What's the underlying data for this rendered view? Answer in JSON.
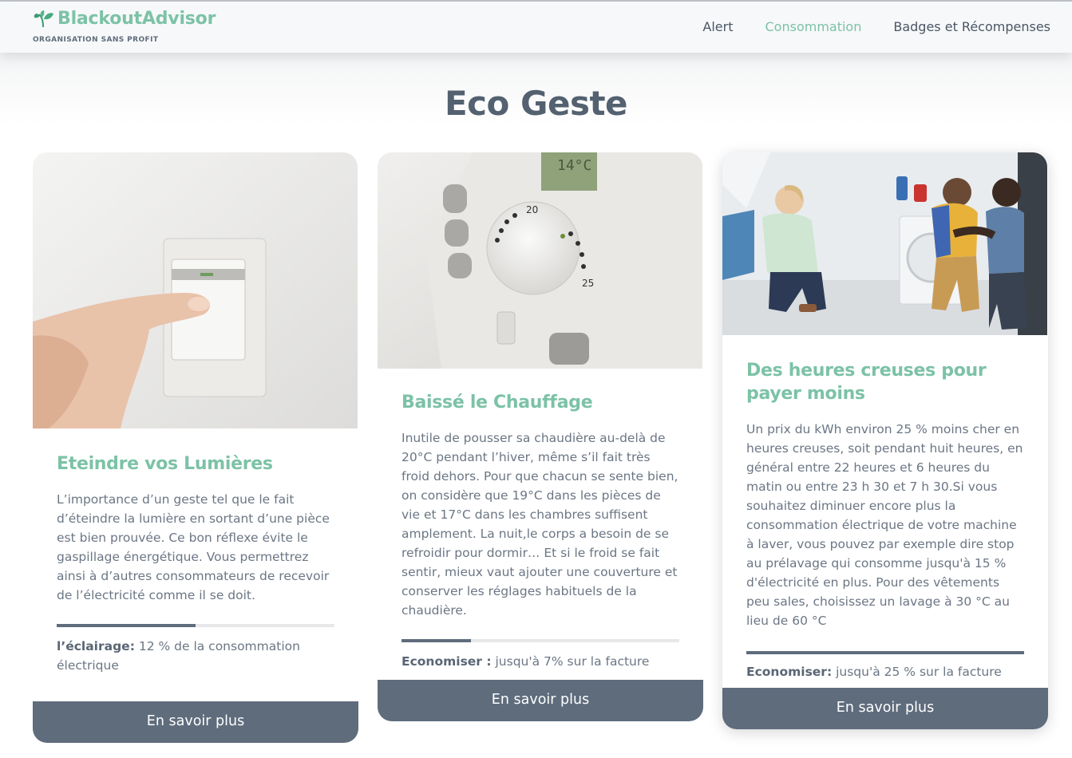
{
  "header": {
    "brand_name": "BlackoutAdvisor",
    "brand_subtitle": "ORGANISATION SANS PROFIT",
    "nav": [
      {
        "label": "Alert",
        "active": false
      },
      {
        "label": "Consommation",
        "active": true
      },
      {
        "label": "Badges et Récompenses",
        "active": false
      }
    ]
  },
  "page_title": "Eco Geste",
  "cards": [
    {
      "image": "hand-pressing-light-switch",
      "title": "Eteindre vos Lumières",
      "description": "L’importance d’un geste tel que le fait d’éteindre la lumière en sortant d’une pièce est bien prouvée. Ce bon réflexe évite le gaspillage énergétique. Vous permettrez ainsi à d’autres consommateurs de recevoir de l’électricité comme il se doit.",
      "progress": 0.5,
      "saving_label": "l’éclairage:",
      "saving_text": " 12 % de la consommation électrique",
      "button": "En savoir plus"
    },
    {
      "image": "thermostat-dial",
      "title": "Baissé le Chauffage",
      "description": "Inutile de pousser sa chaudière au-delà de 20°C pendant l’hiver, même s’il fait très froid dehors. Pour que chacun se sente bien, on considère que 19°C dans les pièces de vie et 17°C dans les chambres suffisent amplement. La nuit,le corps a besoin de se refroidir pour dormir… Et si le froid se fait sentir, mieux vaut ajouter une couverture et conserver les réglages habituels de la chaudière.",
      "progress": 0.25,
      "saving_label": "Economiser :",
      "saving_text": " jusqu'à 7% sur la facture",
      "button": "En savoir plus"
    },
    {
      "image": "people-at-washing-machine",
      "title": "Des heures creuses pour payer moins",
      "description": "Un prix du kWh environ 25 % moins cher en heures creuses, soit pendant huit heures, en général entre 22 heures et 6 heures du matin ou entre 23 h 30 et 7 h 30.Si vous souhaitez diminuer encore plus la consommation électrique de votre machine à laver, vous pouvez par exemple dire stop au prélavage qui consomme jusqu'à 15 % d'électricité en plus. Pour des vêtements peu sales, choisissez un lavage à 30 °C au lieu de 60 °C",
      "progress": 1.0,
      "saving_label": "Economiser:",
      "saving_text": " jusqu'à 25 % sur la facture",
      "button": "En savoir plus"
    }
  ],
  "thermostat": {
    "dial_low": "20",
    "dial_high": "25",
    "display": "14°C"
  },
  "colors": {
    "accent": "#7cc2a7",
    "slate": "#5e6c7c",
    "title": "#536170"
  }
}
